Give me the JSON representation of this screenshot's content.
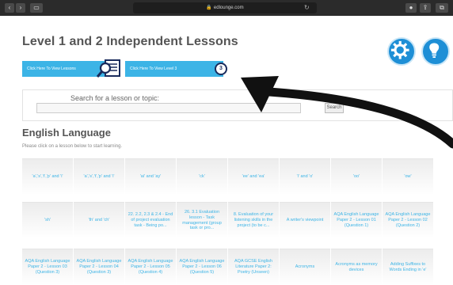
{
  "browser": {
    "url": "edlounge.com"
  },
  "page": {
    "title": "Level 1 and 2 Independent Lessons",
    "view_lessons_label": "Click Here To View Lessons",
    "view_level3_label": "Click Here To View Level 3",
    "level_badge": "3",
    "search_label": "Search for a lesson or topic:",
    "search_value": "",
    "search_button": "Search"
  },
  "section": {
    "title": "English Language",
    "subtitle": "Please click on a lesson below to start learning."
  },
  "lessons_rows": [
    [
      "'a','s','t','p' and 'i'",
      "'a','s','t','p' and 'i'",
      "'ai' and 'ay'",
      "'ck'",
      "'ee' and 'ea'",
      "'i' and 'o'",
      "'oo'",
      "'ow'"
    ],
    [
      "'sh'",
      "'th' and 'ch'",
      "22. 2.2, 2.3 & 2.4 - End of project evaluation task - Being po...",
      "26. 3.1 Evaluation lesson - Task management (group task or pro...",
      "8. Evaluation of your listening skills in the project (to be c...",
      "A writer's viewpoint",
      "AQA English Language Paper 2 - Lesson 01 (Question 1)",
      "AQA English Language Paper 2 - Lesson 02 (Question 2)"
    ],
    [
      "AQA English Language Paper 2 - Lesson 03 (Question 3)",
      "AQA English Language Paper 2 - Lesson 04 (Question 3)",
      "AQA English Language Paper 2 - Lesson 05 (Question 4)",
      "AQA English Language Paper 2 - Lesson 06 (Question 5)",
      "AQA GCSE English Literature Paper 2: Poetry (Unseen)",
      "Acronyms",
      "Acronyms as memory devices",
      "Adding Suffixes to Words Ending in 'e'"
    ]
  ],
  "icons": {
    "settings": "gear-icon",
    "help": "lightbulb-icon",
    "view_lessons": "magnifier-icon"
  },
  "colors": {
    "accent": "#3cb4e6",
    "icon_blue": "#1e8fd6",
    "title_gray": "#555555"
  }
}
